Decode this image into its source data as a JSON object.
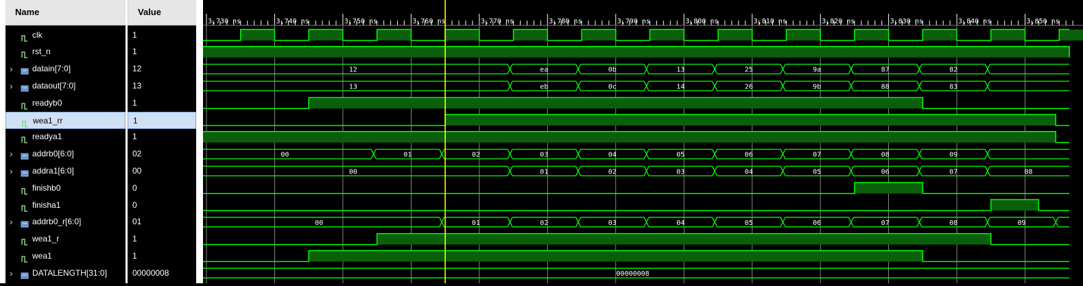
{
  "header": {
    "name_label": "Name",
    "value_label": "Value"
  },
  "colors": {
    "wave": "#00ff00",
    "wave_fill": "#0a5f0a",
    "cursor": "#ffff00",
    "grid": "#a8a8a8",
    "selected_bg": "#cfe0f5"
  },
  "cursor_time": "3,765",
  "time_ticks": [
    "3,730 ns",
    "3,740 ns",
    "3,750 ns",
    "3,760 ns",
    "3,770 ns",
    "3,780 ns",
    "3,790 ns",
    "3,800 ns",
    "3,810 ns",
    "3,820 ns",
    "3,830 ns",
    "3,840 ns",
    "3,850 ns"
  ],
  "signals": [
    {
      "name": "clk",
      "value": "1",
      "kind": "bit",
      "expandable": false,
      "icon": "bit-signal-icon"
    },
    {
      "name": "rst_n",
      "value": "1",
      "kind": "bit",
      "expandable": false,
      "icon": "bit-signal-icon"
    },
    {
      "name": "datain[7:0]",
      "value": "12",
      "kind": "bus",
      "expandable": true,
      "icon": "bus-signal-icon",
      "segments": [
        "12",
        "ea",
        "0b",
        "13",
        "25",
        "9a",
        "87",
        "82",
        ""
      ]
    },
    {
      "name": "dataout[7:0]",
      "value": "13",
      "kind": "bus",
      "expandable": true,
      "icon": "bus-signal-icon",
      "segments": [
        "13",
        "eb",
        "0c",
        "14",
        "26",
        "9b",
        "88",
        "83",
        ""
      ]
    },
    {
      "name": "readyb0",
      "value": "1",
      "kind": "bit",
      "expandable": false,
      "icon": "bit-signal-icon"
    },
    {
      "name": "wea1_rr",
      "value": "1",
      "kind": "bit",
      "expandable": false,
      "icon": "bit-signal-icon",
      "selected": true
    },
    {
      "name": "readya1",
      "value": "1",
      "kind": "bit",
      "expandable": false,
      "icon": "bit-signal-icon"
    },
    {
      "name": "addrb0[6:0]",
      "value": "02",
      "kind": "bus",
      "expandable": true,
      "icon": "bus-signal-icon",
      "segments": [
        "00",
        "01",
        "02",
        "03",
        "04",
        "05",
        "06",
        "07",
        "08",
        "09",
        ""
      ]
    },
    {
      "name": "addra1[6:0]",
      "value": "00",
      "kind": "bus",
      "expandable": true,
      "icon": "bus-signal-icon",
      "segments": [
        "00",
        "01",
        "02",
        "03",
        "04",
        "05",
        "06",
        "07",
        "08"
      ]
    },
    {
      "name": "finishb0",
      "value": "0",
      "kind": "bit",
      "expandable": false,
      "icon": "bit-signal-icon"
    },
    {
      "name": "finisha1",
      "value": "0",
      "kind": "bit",
      "expandable": false,
      "icon": "bit-signal-icon"
    },
    {
      "name": "addrb0_r[6:0]",
      "value": "01",
      "kind": "bus",
      "expandable": true,
      "icon": "bus-signal-icon",
      "segments": [
        "00",
        "01",
        "02",
        "03",
        "04",
        "05",
        "06",
        "07",
        "08",
        "09",
        ""
      ]
    },
    {
      "name": "wea1_r",
      "value": "1",
      "kind": "bit",
      "expandable": false,
      "icon": "bit-signal-icon"
    },
    {
      "name": "wea1",
      "value": "1",
      "kind": "bit",
      "expandable": false,
      "icon": "bit-signal-icon"
    },
    {
      "name": "DATALENGTH[31:0]",
      "value": "00000008",
      "kind": "bus",
      "expandable": true,
      "icon": "bus-signal-icon",
      "segments": [
        "00000008"
      ]
    }
  ]
}
